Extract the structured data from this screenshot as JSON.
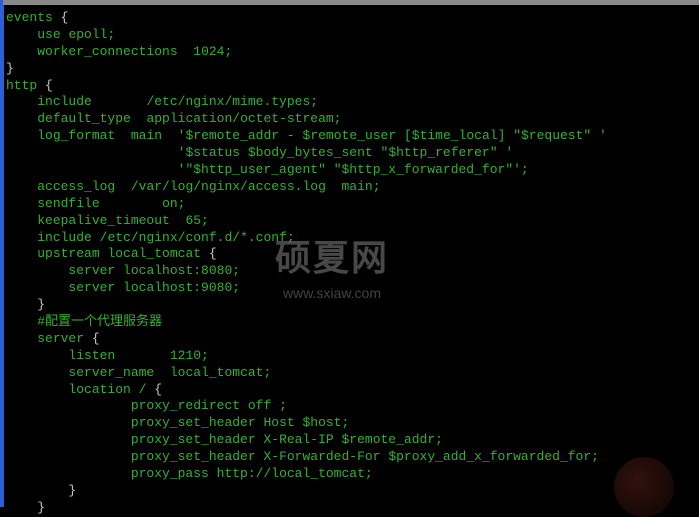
{
  "watermark": {
    "title": "硕夏网",
    "subtitle": "www.sxiaw.com"
  },
  "code": {
    "lines": [
      "events {",
      "    use epoll;",
      "    worker_connections  1024;",
      "}",
      "http {",
      "    include       /etc/nginx/mime.types;",
      "    default_type  application/octet-stream;",
      "    log_format  main  '$remote_addr - $remote_user [$time_local] \"$request\" '",
      "                      '$status $body_bytes_sent \"$http_referer\" '",
      "                      '\"$http_user_agent\" \"$http_x_forwarded_for\"';",
      "    access_log  /var/log/nginx/access.log  main;",
      "    sendfile        on;",
      "    keepalive_timeout  65;",
      "    include /etc/nginx/conf.d/*.conf;",
      "    upstream local_tomcat {",
      "        server localhost:8080;",
      "        server localhost:9080;",
      "    }",
      "    #配置一个代理服务器",
      "    server {",
      "        listen       1210;",
      "        server_name  local_tomcat;",
      "        location / {",
      "                proxy_redirect off ;",
      "                proxy_set_header Host $host;",
      "                proxy_set_header X-Real-IP $remote_addr;",
      "                proxy_set_header X-Forwarded-For $proxy_add_x_forwarded_for;",
      "                proxy_pass http://local_tomcat;",
      "        }",
      "    }"
    ]
  }
}
